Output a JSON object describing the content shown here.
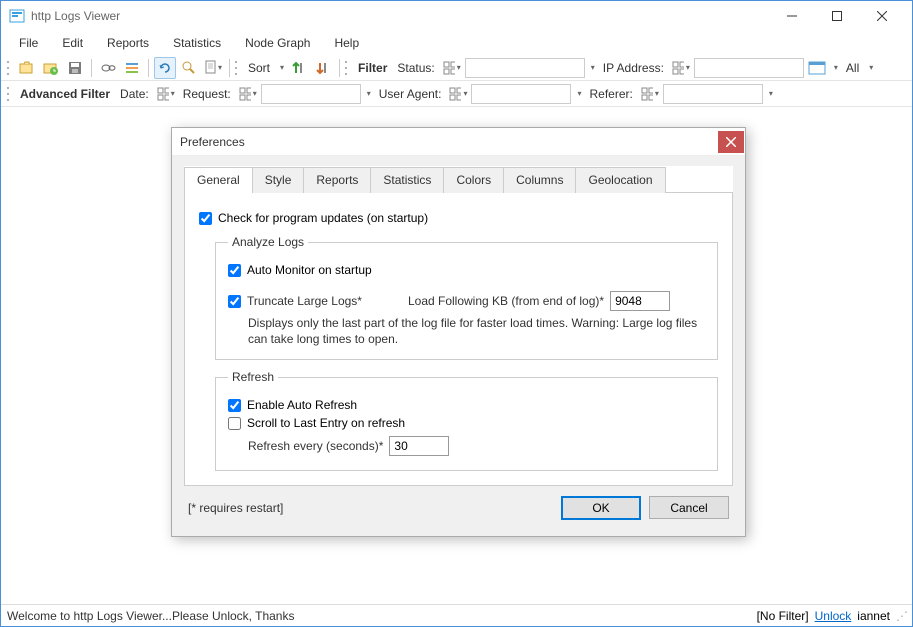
{
  "window": {
    "title": "http Logs Viewer"
  },
  "menu": {
    "file": "File",
    "edit": "Edit",
    "reports": "Reports",
    "statistics": "Statistics",
    "nodegraph": "Node Graph",
    "help": "Help"
  },
  "toolbar1": {
    "sort": "Sort",
    "filter": "Filter",
    "status": "Status:",
    "ip": "IP Address:",
    "all": "All"
  },
  "toolbar2": {
    "advfilter": "Advanced Filter",
    "date": "Date:",
    "request": "Request:",
    "useragent": "User Agent:",
    "referer": "Referer:"
  },
  "dialog": {
    "title": "Preferences",
    "tabs": {
      "general": "General",
      "style": "Style",
      "reports": "Reports",
      "statistics": "Statistics",
      "colors": "Colors",
      "columns": "Columns",
      "geo": "Geolocation"
    },
    "general": {
      "check_updates": "Check for program updates (on startup)",
      "analyze_legend": "Analyze Logs",
      "auto_monitor": "Auto Monitor on startup",
      "truncate": "Truncate Large Logs*",
      "load_kb": "Load Following KB (from end of log)*",
      "kb_value": "9048",
      "truncate_hint": "Displays only the last part of the log file for faster load times. Warning: Large log files can take long times to open.",
      "refresh_legend": "Refresh",
      "enable_refresh": "Enable Auto Refresh",
      "scroll_last": "Scroll to Last Entry on refresh",
      "refresh_every": "Refresh every (seconds)*",
      "refresh_value": "30"
    },
    "footer": {
      "note": "[* requires restart]",
      "ok": "OK",
      "cancel": "Cancel"
    }
  },
  "statusbar": {
    "welcome": "Welcome to http Logs Viewer...Please Unlock, Thanks",
    "nofilter": "[No Filter]",
    "unlock": "Unlock",
    "user": "iannet"
  }
}
